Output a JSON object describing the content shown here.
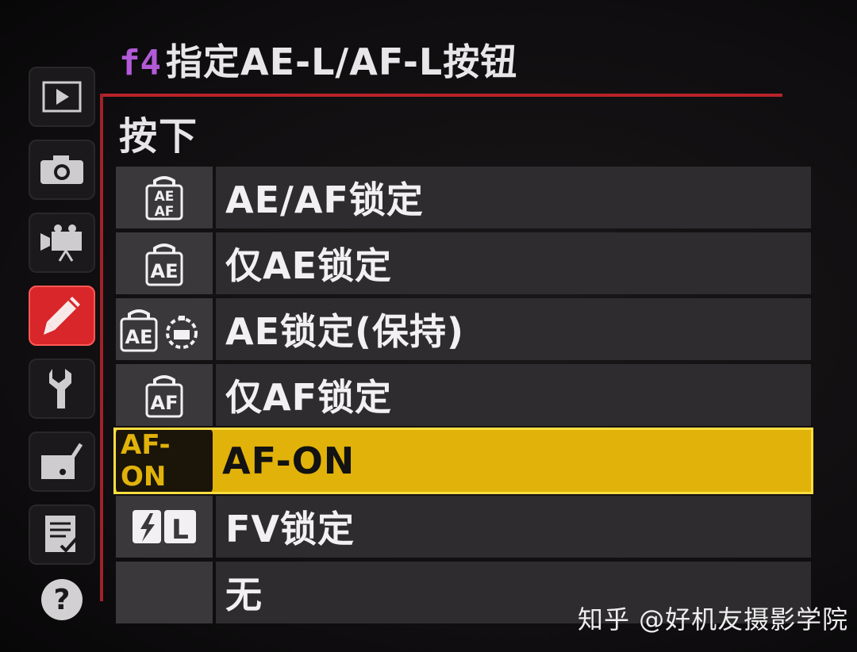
{
  "header": {
    "code": "f4",
    "title": "指定AE-L/AF-L按钮"
  },
  "subheading": "按下",
  "sidebar": {
    "tabs": [
      {
        "name": "playback",
        "icon": "play-icon"
      },
      {
        "name": "shooting",
        "icon": "camera-icon"
      },
      {
        "name": "movie",
        "icon": "movie-camera-icon"
      },
      {
        "name": "custom-settings",
        "icon": "pencil-icon",
        "active": true
      },
      {
        "name": "setup",
        "icon": "wrench-icon"
      },
      {
        "name": "retouch",
        "icon": "retouch-brush-icon"
      },
      {
        "name": "my-menu",
        "icon": "checklist-icon"
      },
      {
        "name": "help",
        "icon": "help-icon",
        "label": "?"
      }
    ]
  },
  "options": [
    {
      "icon": "ae-af-lock-icon",
      "icon_text": "AE/AF",
      "label": "AE/AF锁定"
    },
    {
      "icon": "ae-lock-icon",
      "icon_text": "AE",
      "label": "仅AE锁定"
    },
    {
      "icon": "ae-lock-hold-icon",
      "icon_text": "AE",
      "label": "AE锁定(保持)"
    },
    {
      "icon": "af-lock-icon",
      "icon_text": "AF",
      "label": "仅AF锁定"
    },
    {
      "icon": "af-on-icon",
      "icon_text": "AF-ON",
      "label": "AF-ON",
      "selected": true
    },
    {
      "icon": "fv-lock-icon",
      "icon_text": "L",
      "label": "FV锁定"
    },
    {
      "icon": "none-icon",
      "icon_text": "",
      "label": "无"
    }
  ],
  "watermark": "知乎 @好机友摄影学院",
  "colors": {
    "accent_red": "#d8262a",
    "selection_yellow": "#e1b20a",
    "title_code_purple": "#b25ad8"
  }
}
